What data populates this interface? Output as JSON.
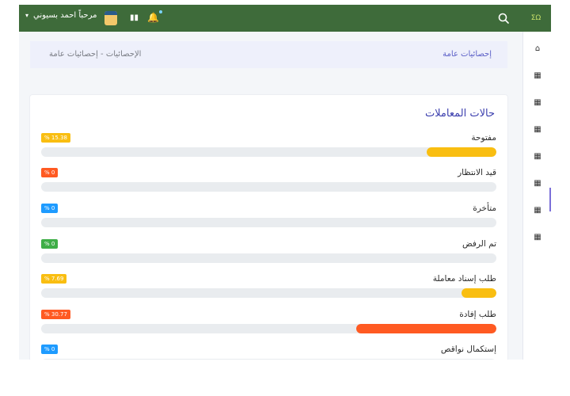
{
  "header": {
    "user_name": "مرحباً احمد بسيوني",
    "caret": "▾",
    "bars_icon": "bar-chart-icon",
    "bell_icon": "bell-icon",
    "calendar_icon": "calendar-icon",
    "search_icon": "search-icon",
    "logo_text": "ΣΩ"
  },
  "breadcrumb": {
    "title": "إحصائيات عامة",
    "path": "الإحصائيات - إحصائيات عامة"
  },
  "card": {
    "title": "حالات المعاملات",
    "items": [
      {
        "label": "مفتوحة",
        "badge": "% 15.38",
        "percent": 15.38,
        "color": "#f9be11"
      },
      {
        "label": "قيد الانتظار",
        "badge": "% 0",
        "percent": 0,
        "color": "#ff5a22"
      },
      {
        "label": "متأخرة",
        "badge": "% 0",
        "percent": 0,
        "color": "#1e9bff"
      },
      {
        "label": "تم الرفض",
        "badge": "% 0",
        "percent": 0,
        "color": "#3fae47"
      },
      {
        "label": "طلب إسناد معاملة",
        "badge": "% 7.69",
        "percent": 7.69,
        "color": "#f9be11"
      },
      {
        "label": "طلب إفادة",
        "badge": "% 30.77",
        "percent": 30.77,
        "color": "#ff5a22"
      },
      {
        "label": "إستكمال نواقص",
        "badge": "% 0",
        "percent": 0,
        "color": "#1e9bff"
      }
    ]
  },
  "sidebar": {
    "items": [
      {
        "icon": "home-icon",
        "glyph": "⌂"
      },
      {
        "icon": "grid-icon",
        "glyph": "▦"
      },
      {
        "icon": "grid-icon",
        "glyph": "▦"
      },
      {
        "icon": "grid-icon",
        "glyph": "▦"
      },
      {
        "icon": "grid-icon",
        "glyph": "▦"
      },
      {
        "icon": "grid-icon",
        "glyph": "▦"
      },
      {
        "icon": "grid-icon",
        "glyph": "▦"
      },
      {
        "icon": "grid-icon",
        "glyph": "▦"
      }
    ]
  }
}
